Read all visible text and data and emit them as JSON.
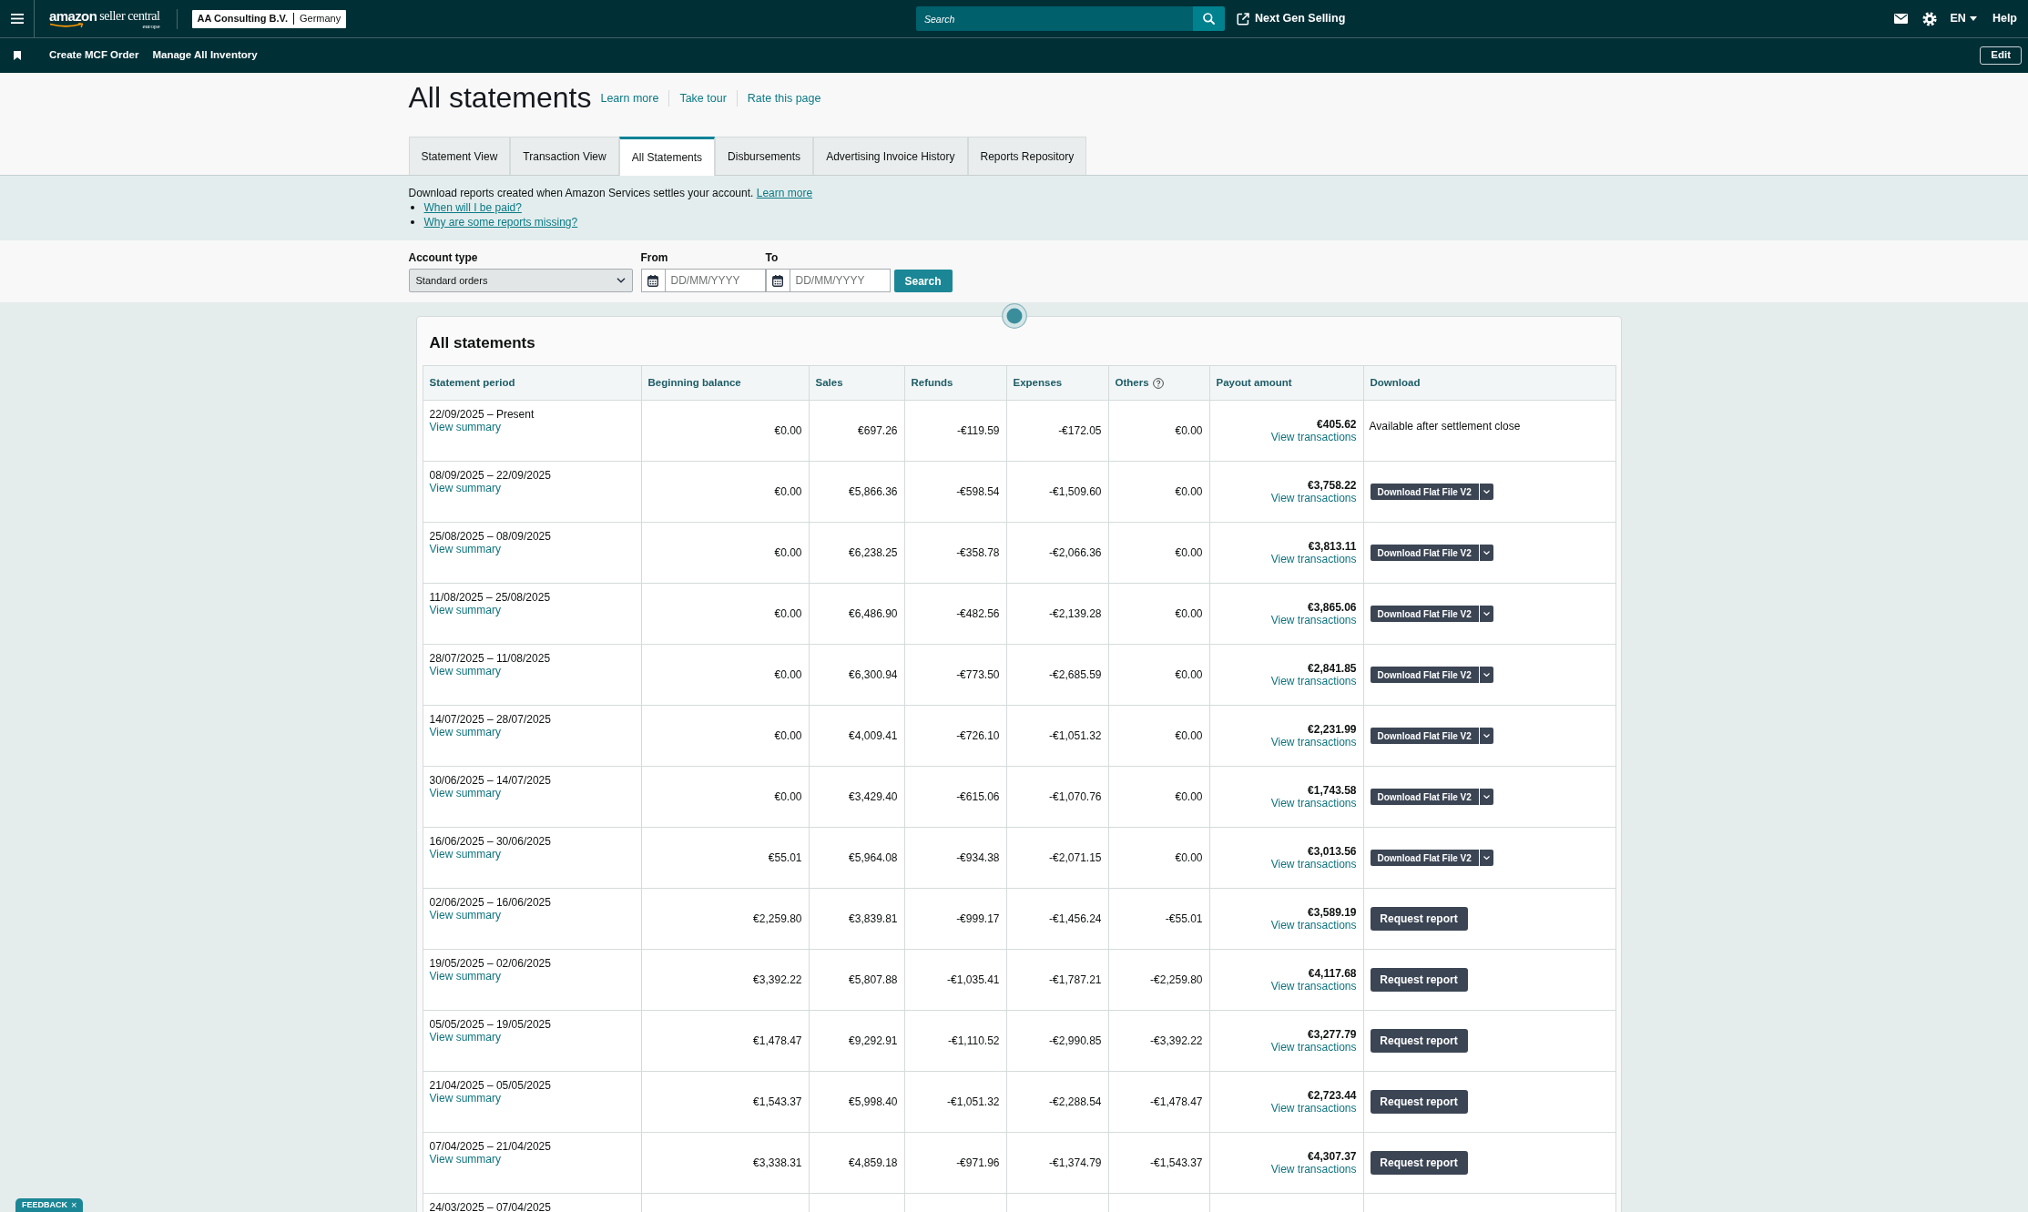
{
  "top_nav": {
    "logo": {
      "brand": "amazon",
      "product": "seller central",
      "region": "europe"
    },
    "account": {
      "name": "AA Consulting B.V.",
      "marketplace": "Germany"
    },
    "search": {
      "placeholder": "Search"
    },
    "next_gen_link": "Next Gen Selling",
    "language": "EN",
    "help": "Help"
  },
  "shortcut_bar": {
    "links": [
      "Create MCF Order",
      "Manage All Inventory"
    ],
    "edit_button": "Edit"
  },
  "page_header": {
    "title": "All statements",
    "links": [
      "Learn more",
      "Take tour",
      "Rate this page"
    ]
  },
  "tabs": [
    {
      "label": "Statement View",
      "selected": false
    },
    {
      "label": "Transaction View",
      "selected": false
    },
    {
      "label": "All Statements",
      "selected": true
    },
    {
      "label": "Disbursements",
      "selected": false
    },
    {
      "label": "Advertising Invoice History",
      "selected": false
    },
    {
      "label": "Reports Repository",
      "selected": false
    }
  ],
  "info": {
    "text": "Download reports created when Amazon Services settles your account.",
    "link": "Learn more",
    "bullets": [
      "When will I be paid?",
      "Why are some reports missing?"
    ]
  },
  "filters": {
    "account_type": {
      "label": "Account type",
      "value": "Standard orders"
    },
    "from": {
      "label": "From",
      "placeholder": "DD/MM/YYYY"
    },
    "to": {
      "label": "To",
      "placeholder": "DD/MM/YYYY"
    },
    "search_button": "Search"
  },
  "statements": {
    "title": "All statements",
    "columns": [
      {
        "label": "Statement period",
        "kind": "plain"
      },
      {
        "label": "Beginning balance",
        "kind": "plain"
      },
      {
        "label": "Sales",
        "kind": "plain"
      },
      {
        "label": "Refunds",
        "kind": "plain"
      },
      {
        "label": "Expenses",
        "kind": "plain"
      },
      {
        "label": "Others",
        "kind": "help"
      },
      {
        "label": "Payout amount",
        "kind": "plain"
      },
      {
        "label": "Download",
        "kind": "plain"
      }
    ],
    "rows": [
      {
        "period": "22/09/2025 – Present",
        "view_summary": "View summary",
        "beginning_balance": "€0.00",
        "sales": "€697.26",
        "refunds": "-€119.59",
        "expenses": "-€172.05",
        "others": "€0.00",
        "payout": "€405.62",
        "view_transactions": "View transactions",
        "download": {
          "kind": "text",
          "label": "Available after settlement close"
        }
      },
      {
        "period": "08/09/2025 – 22/09/2025",
        "view_summary": "View summary",
        "beginning_balance": "€0.00",
        "sales": "€5,866.36",
        "refunds": "-€598.54",
        "expenses": "-€1,509.60",
        "others": "€0.00",
        "payout": "€3,758.22",
        "view_transactions": "View transactions",
        "download": {
          "kind": "split_button",
          "label": "Download Flat File V2"
        }
      },
      {
        "period": "25/08/2025 – 08/09/2025",
        "view_summary": "View summary",
        "beginning_balance": "€0.00",
        "sales": "€6,238.25",
        "refunds": "-€358.78",
        "expenses": "-€2,066.36",
        "others": "€0.00",
        "payout": "€3,813.11",
        "view_transactions": "View transactions",
        "download": {
          "kind": "split_button",
          "label": "Download Flat File V2"
        }
      },
      {
        "period": "11/08/2025 – 25/08/2025",
        "view_summary": "View summary",
        "beginning_balance": "€0.00",
        "sales": "€6,486.90",
        "refunds": "-€482.56",
        "expenses": "-€2,139.28",
        "others": "€0.00",
        "payout": "€3,865.06",
        "view_transactions": "View transactions",
        "download": {
          "kind": "split_button",
          "label": "Download Flat File V2"
        }
      },
      {
        "period": "28/07/2025 – 11/08/2025",
        "view_summary": "View summary",
        "beginning_balance": "€0.00",
        "sales": "€6,300.94",
        "refunds": "-€773.50",
        "expenses": "-€2,685.59",
        "others": "€0.00",
        "payout": "€2,841.85",
        "view_transactions": "View transactions",
        "download": {
          "kind": "split_button",
          "label": "Download Flat File V2"
        }
      },
      {
        "period": "14/07/2025 – 28/07/2025",
        "view_summary": "View summary",
        "beginning_balance": "€0.00",
        "sales": "€4,009.41",
        "refunds": "-€726.10",
        "expenses": "-€1,051.32",
        "others": "€0.00",
        "payout": "€2,231.99",
        "view_transactions": "View transactions",
        "download": {
          "kind": "split_button",
          "label": "Download Flat File V2"
        }
      },
      {
        "period": "30/06/2025 – 14/07/2025",
        "view_summary": "View summary",
        "beginning_balance": "€0.00",
        "sales": "€3,429.40",
        "refunds": "-€615.06",
        "expenses": "-€1,070.76",
        "others": "€0.00",
        "payout": "€1,743.58",
        "view_transactions": "View transactions",
        "download": {
          "kind": "split_button",
          "label": "Download Flat File V2"
        }
      },
      {
        "period": "16/06/2025 – 30/06/2025",
        "view_summary": "View summary",
        "beginning_balance": "€55.01",
        "sales": "€5,964.08",
        "refunds": "-€934.38",
        "expenses": "-€2,071.15",
        "others": "€0.00",
        "payout": "€3,013.56",
        "view_transactions": "View transactions",
        "download": {
          "kind": "split_button",
          "label": "Download Flat File V2"
        }
      },
      {
        "period": "02/06/2025 – 16/06/2025",
        "view_summary": "View summary",
        "beginning_balance": "€2,259.80",
        "sales": "€3,839.81",
        "refunds": "-€999.17",
        "expenses": "-€1,456.24",
        "others": "-€55.01",
        "payout": "€3,589.19",
        "view_transactions": "View transactions",
        "download": {
          "kind": "button",
          "label": "Request report"
        }
      },
      {
        "period": "19/05/2025 – 02/06/2025",
        "view_summary": "View summary",
        "beginning_balance": "€3,392.22",
        "sales": "€5,807.88",
        "refunds": "-€1,035.41",
        "expenses": "-€1,787.21",
        "others": "-€2,259.80",
        "payout": "€4,117.68",
        "view_transactions": "View transactions",
        "download": {
          "kind": "button",
          "label": "Request report"
        }
      },
      {
        "period": "05/05/2025 – 19/05/2025",
        "view_summary": "View summary",
        "beginning_balance": "€1,478.47",
        "sales": "€9,292.91",
        "refunds": "-€1,110.52",
        "expenses": "-€2,990.85",
        "others": "-€3,392.22",
        "payout": "€3,277.79",
        "view_transactions": "View transactions",
        "download": {
          "kind": "button",
          "label": "Request report"
        }
      },
      {
        "period": "21/04/2025 – 05/05/2025",
        "view_summary": "View summary",
        "beginning_balance": "€1,543.37",
        "sales": "€5,998.40",
        "refunds": "-€1,051.32",
        "expenses": "-€2,288.54",
        "others": "-€1,478.47",
        "payout": "€2,723.44",
        "view_transactions": "View transactions",
        "download": {
          "kind": "button",
          "label": "Request report"
        }
      },
      {
        "period": "07/04/2025 – 21/04/2025",
        "view_summary": "View summary",
        "beginning_balance": "€3,338.31",
        "sales": "€4,859.18",
        "refunds": "-€971.96",
        "expenses": "-€1,374.79",
        "others": "-€1,543.37",
        "payout": "€4,307.37",
        "view_transactions": "View transactions",
        "download": {
          "kind": "button",
          "label": "Request report"
        }
      },
      {
        "period": "24/03/2025 – 07/04/2025"
      }
    ]
  },
  "feedback": {
    "label": "FEEDBACK",
    "close": "×"
  }
}
